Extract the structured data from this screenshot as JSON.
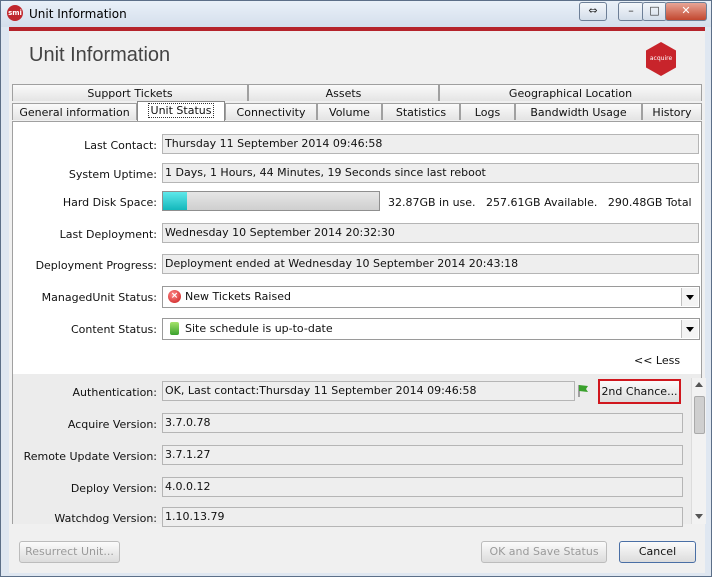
{
  "window": {
    "app_icon_text": "smi",
    "title": "Unit Information",
    "controls": {
      "restore": "⇔",
      "minimize": "–",
      "maximize": "□",
      "close": "✕"
    }
  },
  "header": {
    "title": "Unit Information",
    "logo_text": "acquire"
  },
  "tabs_row1": [
    "Support Tickets",
    "Assets",
    "Geographical Location"
  ],
  "tabs_row2": [
    "General information",
    "Unit Status",
    "Connectivity",
    "Volume",
    "Statistics",
    "Logs",
    "Bandwidth Usage",
    "History"
  ],
  "active_tab": "Unit Status",
  "status": {
    "last_contact_label": "Last Contact:",
    "last_contact": "Thursday 11 September 2014 09:46:58",
    "uptime_label": "System Uptime:",
    "uptime": "1 Days, 1 Hours, 44 Minutes, 19 Seconds since last reboot",
    "disk_label": "Hard Disk Space:",
    "disk_used_fraction": 0.113,
    "disk_text": "32.87GB in use.   257.61GB Available.   290.48GB Total",
    "last_deploy_label": "Last Deployment:",
    "last_deploy": "Wednesday 10 September 2014 20:32:30",
    "deploy_progress_label": "Deployment Progress:",
    "deploy_progress": "Deployment ended at Wednesday 10 September 2014 20:43:18",
    "managed_label": "ManagedUnit Status:",
    "managed_value": "New Tickets Raised",
    "content_label": "Content Status:",
    "content_value": "Site schedule is up-to-date",
    "less_link": "<< Less"
  },
  "details": {
    "auth_label": "Authentication:",
    "auth_value": "OK, Last contact:Thursday 11 September 2014 09:46:58",
    "second_chance": "2nd Chance...",
    "acquire_label": "Acquire Version:",
    "acquire_value": "3.7.0.78",
    "remote_label": "Remote Update Version:",
    "remote_value": "3.7.1.27",
    "deploy_label": "Deploy Version:",
    "deploy_value": "4.0.0.12",
    "watchdog_label": "Watchdog Version:",
    "watchdog_value": "1.10.13.79"
  },
  "footer": {
    "resurrect": "Resurrect Unit...",
    "ok_save": "OK and Save Status",
    "cancel": "Cancel"
  },
  "colors": {
    "accent": "#c8242b",
    "highlight": "#d0161d",
    "progress": "#14b7bb"
  }
}
